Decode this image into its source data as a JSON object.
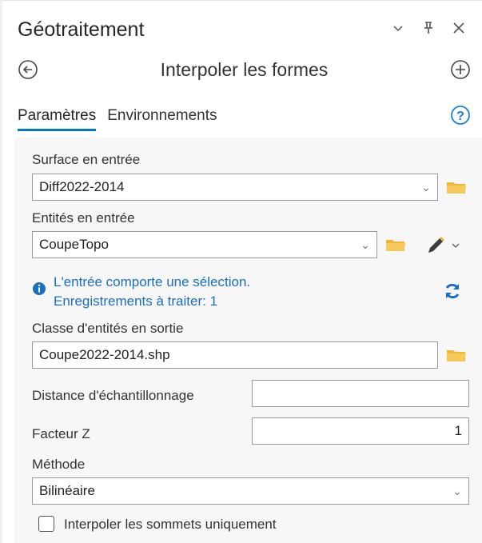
{
  "pane": {
    "title": "Géotraitement",
    "controls": {
      "options_icon": "chevron-down-icon",
      "pin_icon": "pin-icon",
      "close_icon": "close-icon"
    }
  },
  "tool": {
    "title": "Interpoler les formes",
    "back_icon": "back-arrow-icon",
    "add_icon": "add-icon"
  },
  "tabs": [
    {
      "label": "Paramètres",
      "active": true
    },
    {
      "label": "Environnements",
      "active": false
    }
  ],
  "help_icon": "help-icon",
  "params": {
    "surface": {
      "label": "Surface en entrée",
      "value": "Diff2022-2014"
    },
    "features": {
      "label": "Entités en entrée",
      "value": "CoupeTopo"
    },
    "info": {
      "line1": "L'entrée comporte une sélection.",
      "line2": "Enregistrements à traiter: 1"
    },
    "output": {
      "label": "Classe d'entités en sortie",
      "value": "Coupe2022-2014.shp"
    },
    "sample_distance": {
      "label": "Distance d'échantillonnage",
      "value": ""
    },
    "z_factor": {
      "label": "Facteur Z",
      "value": "1"
    },
    "method": {
      "label": "Méthode",
      "value": "Bilinéaire"
    },
    "vertices_only": {
      "label": "Interpoler les sommets uniquement",
      "checked": false
    }
  },
  "colors": {
    "accent": "#0079c1",
    "info_text": "#1a6fbf",
    "folder": "#f2b632"
  }
}
